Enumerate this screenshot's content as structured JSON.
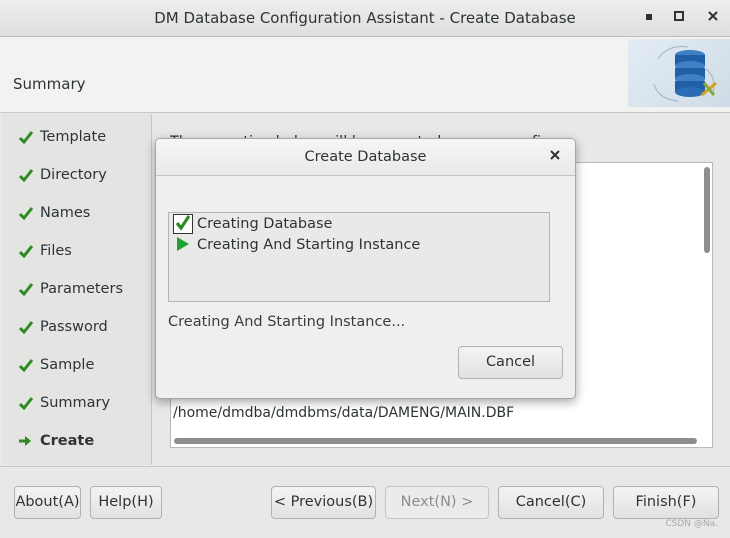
{
  "window": {
    "title": "DM Database Configuration Assistant - Create Database",
    "minimize": "▪",
    "maximize": "□",
    "close": "×"
  },
  "header": {
    "step_title": "Summary"
  },
  "sidebar": {
    "items": [
      {
        "label": "Template",
        "state": "done"
      },
      {
        "label": "Directory",
        "state": "done"
      },
      {
        "label": "Names",
        "state": "done"
      },
      {
        "label": "Files",
        "state": "done"
      },
      {
        "label": "Parameters",
        "state": "done"
      },
      {
        "label": "Password",
        "state": "done"
      },
      {
        "label": "Sample",
        "state": "done"
      },
      {
        "label": "Summary",
        "state": "done"
      },
      {
        "label": "Create",
        "state": "current"
      }
    ]
  },
  "content": {
    "description": "The operation below will be executed on your configure",
    "last_line": "/home/dmdba/dmdbms/data/DAMENG/MAIN.DBF"
  },
  "footer": {
    "about": "About(A)",
    "help": "Help(H)",
    "previous": "< Previous(B)",
    "next": "Next(N) >",
    "cancel": "Cancel(C)",
    "finish": "Finish(F)",
    "watermark": "CSDN @Na."
  },
  "dialog": {
    "title": "Create Database",
    "close": "×",
    "tasks": [
      {
        "label": "Creating Database",
        "state": "checked"
      },
      {
        "label": "Creating And Starting Instance",
        "state": "running"
      }
    ],
    "status": "Creating And Starting Instance...",
    "cancel": "Cancel"
  },
  "colors": {
    "check_green": "#2e8b22",
    "play_green": "#1fa22e",
    "accent": "#2e3436"
  }
}
